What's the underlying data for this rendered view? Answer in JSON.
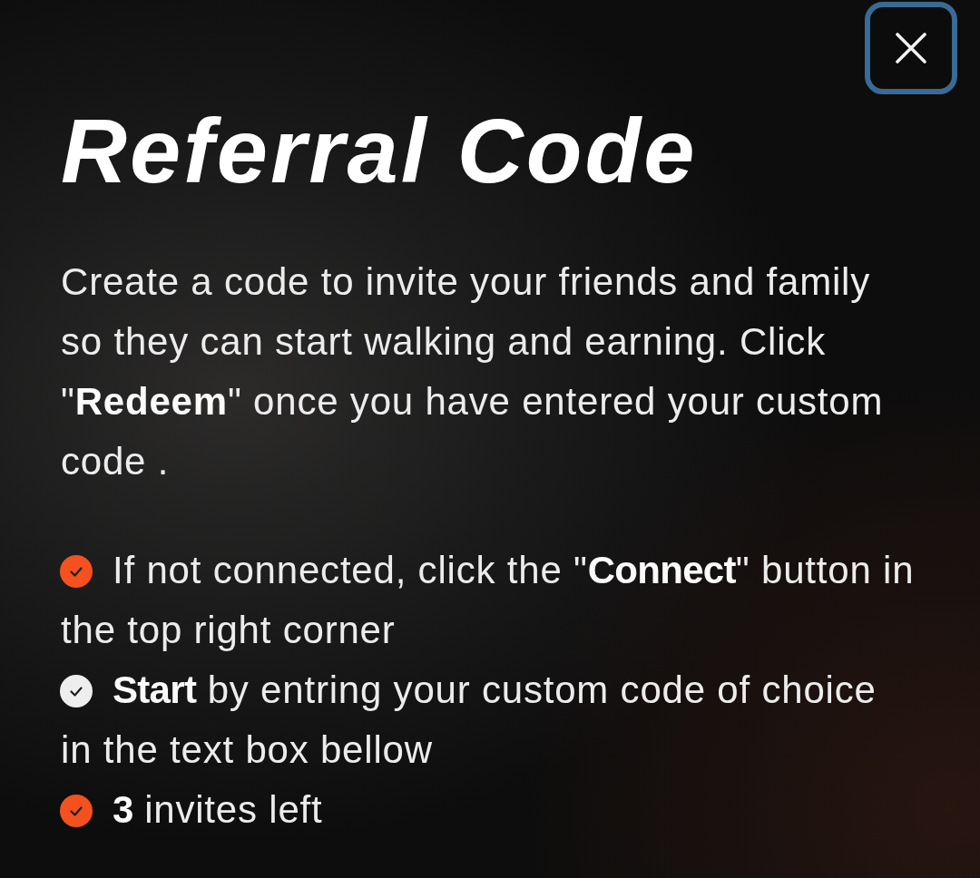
{
  "title": "Referral Code",
  "description": "Create a code to invite your friends and family so they can start walking and earning. Click \"**Redeem**\" once you have entered your custom code .",
  "steps": [
    {
      "color": "#f4511e",
      "text": "If not connected, click the \"**Connect**\" button in the top right corner"
    },
    {
      "color": "#eeeeee",
      "text": "**Start** by entring your custom code of choice in the text box bellow"
    },
    {
      "color": "#f4511e",
      "text": "**3** invites left"
    }
  ]
}
